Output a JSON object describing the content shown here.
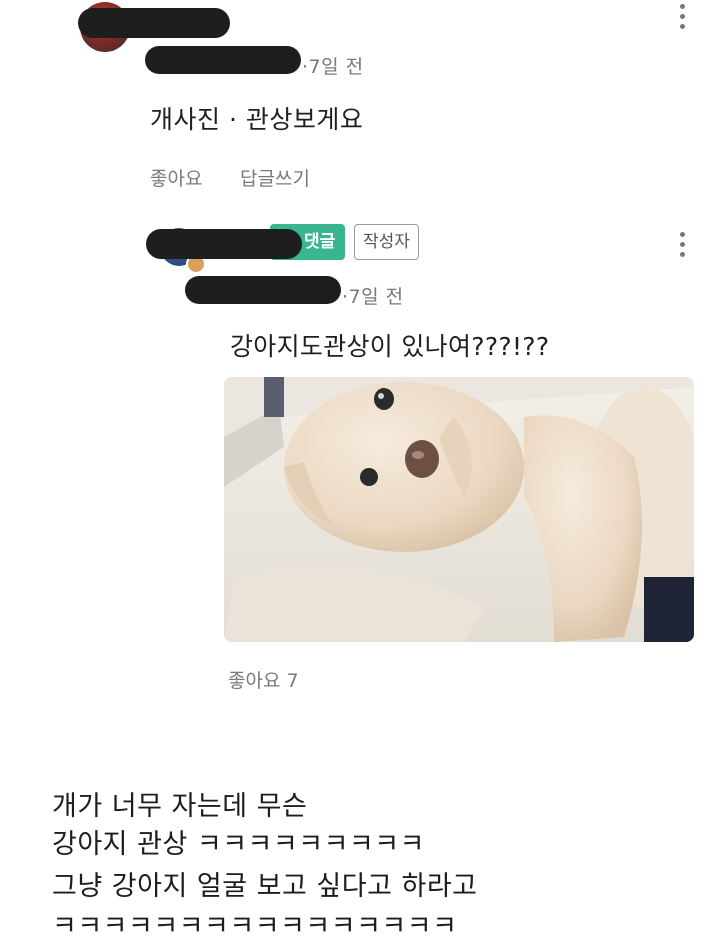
{
  "top_comment": {
    "time": "·7일 전",
    "text": "개사진 · 관상보게요",
    "like_label": "좋아요",
    "reply_label": "답글쓰기"
  },
  "reply": {
    "badge_best": "댓글",
    "badge_author": "작성자",
    "time": "·7일 전",
    "text": "강아지도관상이 있나여???!??",
    "likes": "좋아요 7"
  },
  "caption": {
    "lines": [
      "개가 너무 자는데 무슨",
      "강아지 관상 ㅋㅋㅋㅋㅋㅋㅋㅋㅋ",
      "그냥 강아지 얼굴 보고 싶다고 하라고",
      "ㅋㅋㅋㅋㅋㅋㅋㅋㅋㅋㅋㅋㅋㅋㅋㅋ"
    ]
  },
  "colors": {
    "badge_green": "#39b58f",
    "text_primary": "#1f1f1f",
    "text_secondary": "#7a7a7a"
  },
  "icons": {
    "more": "kebab-vertical-icon"
  }
}
